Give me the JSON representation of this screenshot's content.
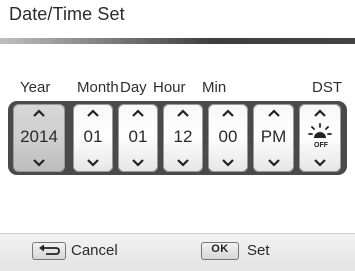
{
  "title": "Date/Time Set",
  "columns": {
    "year": {
      "label": "Year",
      "value": "2014",
      "selected": true
    },
    "month": {
      "label": "Month",
      "value": "01"
    },
    "day": {
      "label": "Day",
      "value": "01"
    },
    "hour": {
      "label": "Hour",
      "value": "12"
    },
    "min": {
      "label": "Min",
      "value": "00"
    },
    "ampm": {
      "label": "",
      "value": "PM"
    },
    "dst": {
      "label": "DST",
      "icon": "dst-off-sun-icon",
      "state_text": "OFF"
    }
  },
  "footer": {
    "cancel_label": "Cancel",
    "set_key": "OK",
    "set_label": "Set"
  },
  "colors": {
    "track": "#4a4a4a",
    "selected_spinner": "#cfcfcf"
  }
}
